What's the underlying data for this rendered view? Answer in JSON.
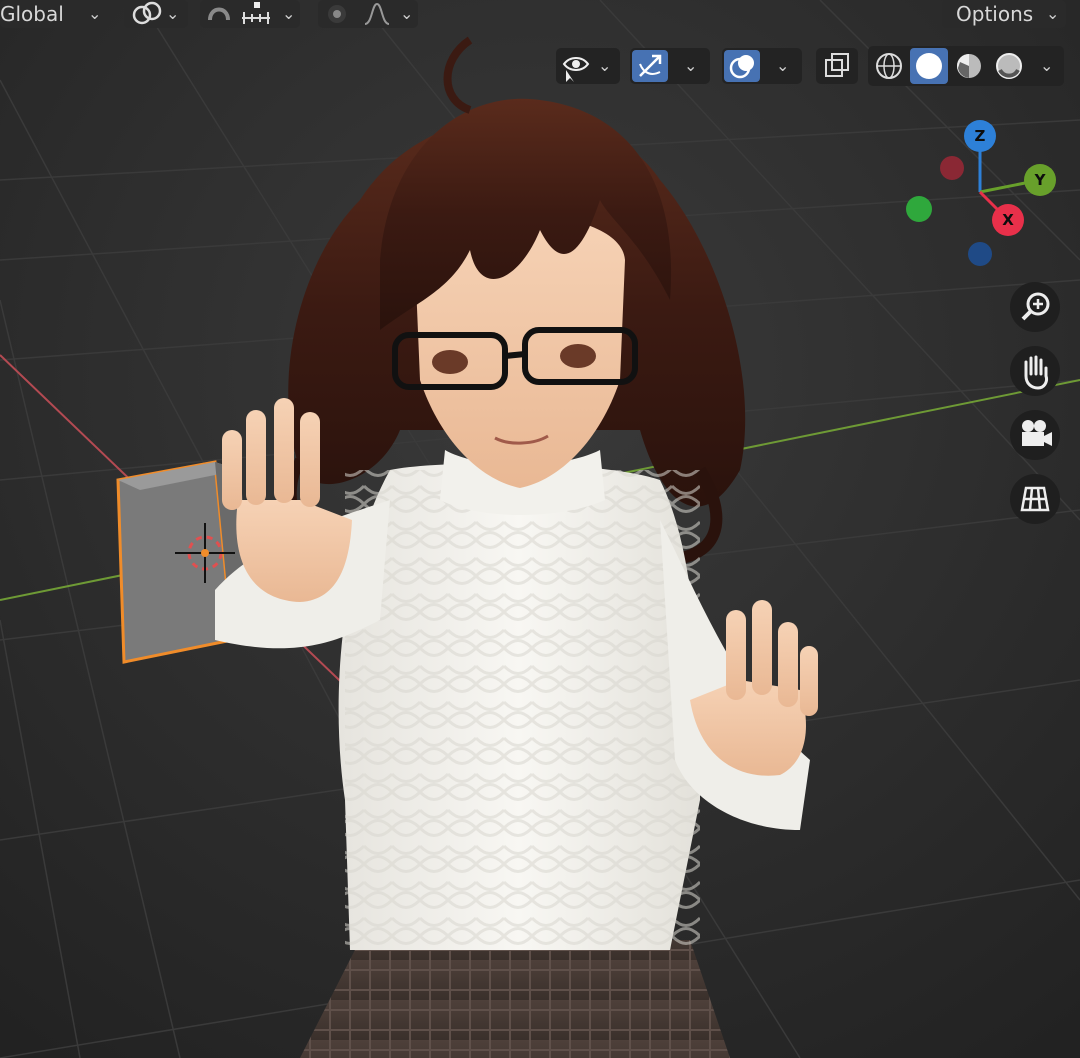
{
  "header": {
    "transform_orientation": "Global",
    "options_label": "Options"
  },
  "viewport_toolbar": {
    "shading_mode": "Solid",
    "icons": [
      "selectability-visibility-icon",
      "gizmo-toggle-icon",
      "overlays-icon",
      "xray-toggle-icon",
      "wireframe-shading-icon",
      "solid-shading-icon",
      "material-preview-icon",
      "rendered-shading-icon"
    ]
  },
  "nav_gizmo": {
    "z_label": "Z",
    "y_label": "Y",
    "x_label": "X",
    "colors": {
      "x": "#e8304a",
      "y": "#68a02b",
      "z": "#2d80d8",
      "x_neg": "#8a2834",
      "y_neg": "#2fa83c",
      "z_neg": "#1f4a86"
    }
  },
  "nav_tools": [
    "zoom-icon",
    "hand-pan-icon",
    "camera-view-icon",
    "orthographic-grid-icon"
  ],
  "scene": {
    "grid_color": "#3a3a3a",
    "x_axis_color": "#b34a52",
    "y_axis_color": "#6e9a35",
    "selection_outline_color": "#f08c2a",
    "character": "anime-girl-avatar"
  }
}
